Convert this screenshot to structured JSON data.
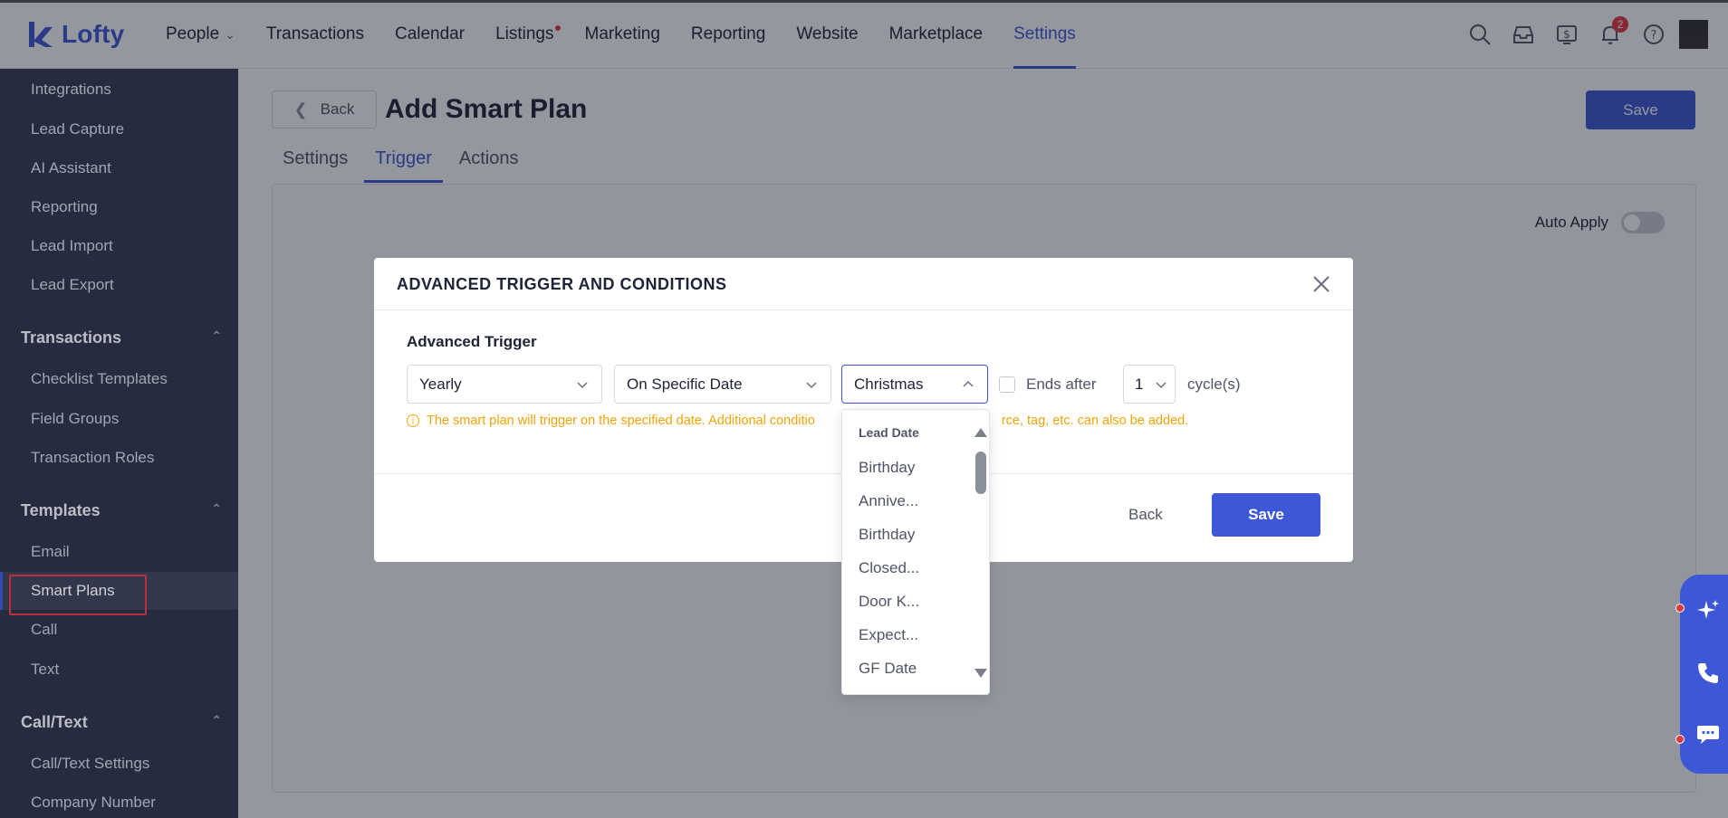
{
  "app": {
    "brand": "Lofty"
  },
  "nav": {
    "items": [
      {
        "label": "People",
        "has_dropdown": true
      },
      {
        "label": "Transactions"
      },
      {
        "label": "Calendar"
      },
      {
        "label": "Listings",
        "has_dot": true
      },
      {
        "label": "Marketing"
      },
      {
        "label": "Reporting"
      },
      {
        "label": "Website"
      },
      {
        "label": "Marketplace"
      },
      {
        "label": "Settings",
        "active": true
      }
    ],
    "notification_count": "2"
  },
  "sidebar": {
    "items_top": [
      "Integrations",
      "Lead Capture",
      "AI Assistant",
      "Reporting",
      "Lead Import",
      "Lead Export"
    ],
    "section_transactions": "Transactions",
    "items_transactions": [
      "Checklist Templates",
      "Field Groups",
      "Transaction Roles"
    ],
    "section_templates": "Templates",
    "items_templates": [
      "Email",
      "Smart Plans",
      "Call",
      "Text"
    ],
    "section_calltext": "Call/Text",
    "items_calltext": [
      "Call/Text Settings",
      "Company Number"
    ]
  },
  "page": {
    "back_label": "Back",
    "title": "Add Smart Plan",
    "save_label": "Save",
    "tabs": [
      "Settings",
      "Trigger",
      "Actions"
    ],
    "active_tab": "Trigger",
    "auto_apply_label": "Auto Apply",
    "auto_apply_on": false
  },
  "modal": {
    "title": "ADVANCED TRIGGER AND CONDITIONS",
    "section_label": "Advanced Trigger",
    "frequency": "Yearly",
    "date_mode": "On Specific Date",
    "date_value": "Christmas",
    "ends_after_label": "Ends after",
    "ends_after_checked": false,
    "cycle_count": "1",
    "cycle_unit": "cycle(s)",
    "hint_before": "The smart plan will trigger on the specified date. Additional conditio",
    "hint_after": "rce, tag, etc. can also be added.",
    "back_label": "Back",
    "save_label": "Save"
  },
  "dropdown": {
    "group_label": "Lead Date",
    "options": [
      "Birthday",
      "Annive...",
      "Birthday",
      "Closed...",
      "Door K...",
      "Expect...",
      "GF Date"
    ]
  },
  "colors": {
    "accent": "#3d57d6",
    "sidebar_bg": "#2b3046",
    "warning": "#f0a30a",
    "danger": "#e5373f"
  },
  "icons": {
    "top": [
      "search-icon",
      "inbox-icon",
      "dollar-icon",
      "bell-icon",
      "help-icon"
    ],
    "float": [
      "sparkle-icon",
      "phone-icon",
      "chat-icon"
    ]
  }
}
